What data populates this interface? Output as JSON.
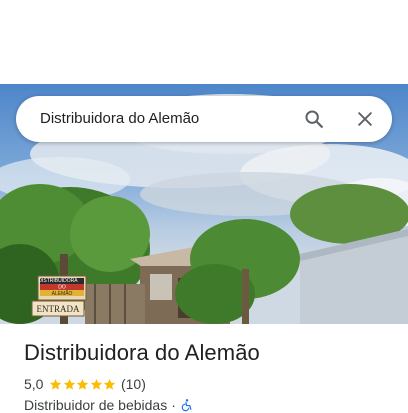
{
  "search": {
    "query": "Distribuidora do Alemão"
  },
  "place": {
    "name": "Distribuidora do Alemão",
    "rating": "5,0",
    "stars": 5,
    "review_count": "(10)",
    "category": "Distribuidor de bebidas",
    "separator": "·"
  },
  "photo": {
    "sign_line1": "DISTRIBUIDORA",
    "sign_line2": "DO",
    "sign_line3": "ALEMÃO",
    "sign_entrance": "ENTRADA"
  },
  "icons": {
    "search": "search-icon",
    "close": "close-icon",
    "star": "star-icon",
    "accessibility": "wheelchair-icon"
  },
  "colors": {
    "star": "#fbbc04",
    "accessibility": "#1a73e8",
    "text_primary": "#202124"
  }
}
